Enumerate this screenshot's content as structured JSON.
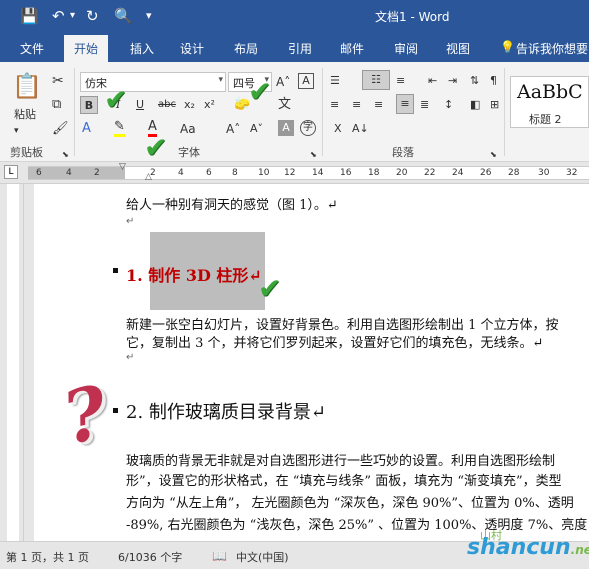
{
  "titlebar": {
    "title": "文档1 - Word"
  },
  "tabs": [
    "文件",
    "开始",
    "插入",
    "设计",
    "布局",
    "引用",
    "邮件",
    "审阅",
    "视图"
  ],
  "tell_me": "告诉我你想要",
  "ribbon": {
    "paste_label": "粘贴",
    "clipboard_label": "剪贴板",
    "font_label": "字体",
    "paragraph_label": "段落",
    "font_name": "仿宋",
    "font_size": "四号",
    "style_preview": "AaBbC",
    "style_name": "标题 2",
    "bold": "B",
    "italic": "I",
    "underline": "U",
    "strike": "abc",
    "subscript": "x₂",
    "superscript": "x²",
    "font_color_glyph": "A",
    "change_case": "Aa"
  },
  "ruler_ticks": [
    "6",
    "4",
    "2",
    "2",
    "4",
    "6",
    "8",
    "10",
    "12",
    "14",
    "16",
    "18",
    "20",
    "22",
    "24",
    "26",
    "28",
    "30",
    "32"
  ],
  "document": {
    "line1": "给人一种别有洞天的感觉（图 1）。↵",
    "heading1": "1.  制作 3D 柱形↵",
    "para1_l1": "新建一张空白幻灯片，设置好背景色。利用自选图形绘制出 1 个立方体，按",
    "para1_l2": "它，复制出 3 个，并将它们罗列起来，设置好它们的填充色，无线条。↵",
    "heading2": "2.  制作玻璃质目录背景↵",
    "para2_l1": "玻璃质的背景无非就是对自选图形进行一些巧妙的设置。利用自选图形绘制",
    "para2_l2": "形”，设置它的形状格式，在 “填充与线条” 面板，填充为 “渐变填充”，类型",
    "para2_l3": "方向为 “从左上角”， 左光圈颜色为 “深灰色，深色 90%”、位置为 0%、透明",
    "para2_l4": "-89%, 右光圈颜色为 “浅灰色，深色 25%” 、位置为 100%、透明度 7%、亮度"
  },
  "status": {
    "page": "第 1 页，共 1 页",
    "words": "6/1036 个字",
    "language": "中文(中国)"
  },
  "watermark": "shancun",
  "watermark_sub": ".net",
  "watermark_logo": "山村"
}
